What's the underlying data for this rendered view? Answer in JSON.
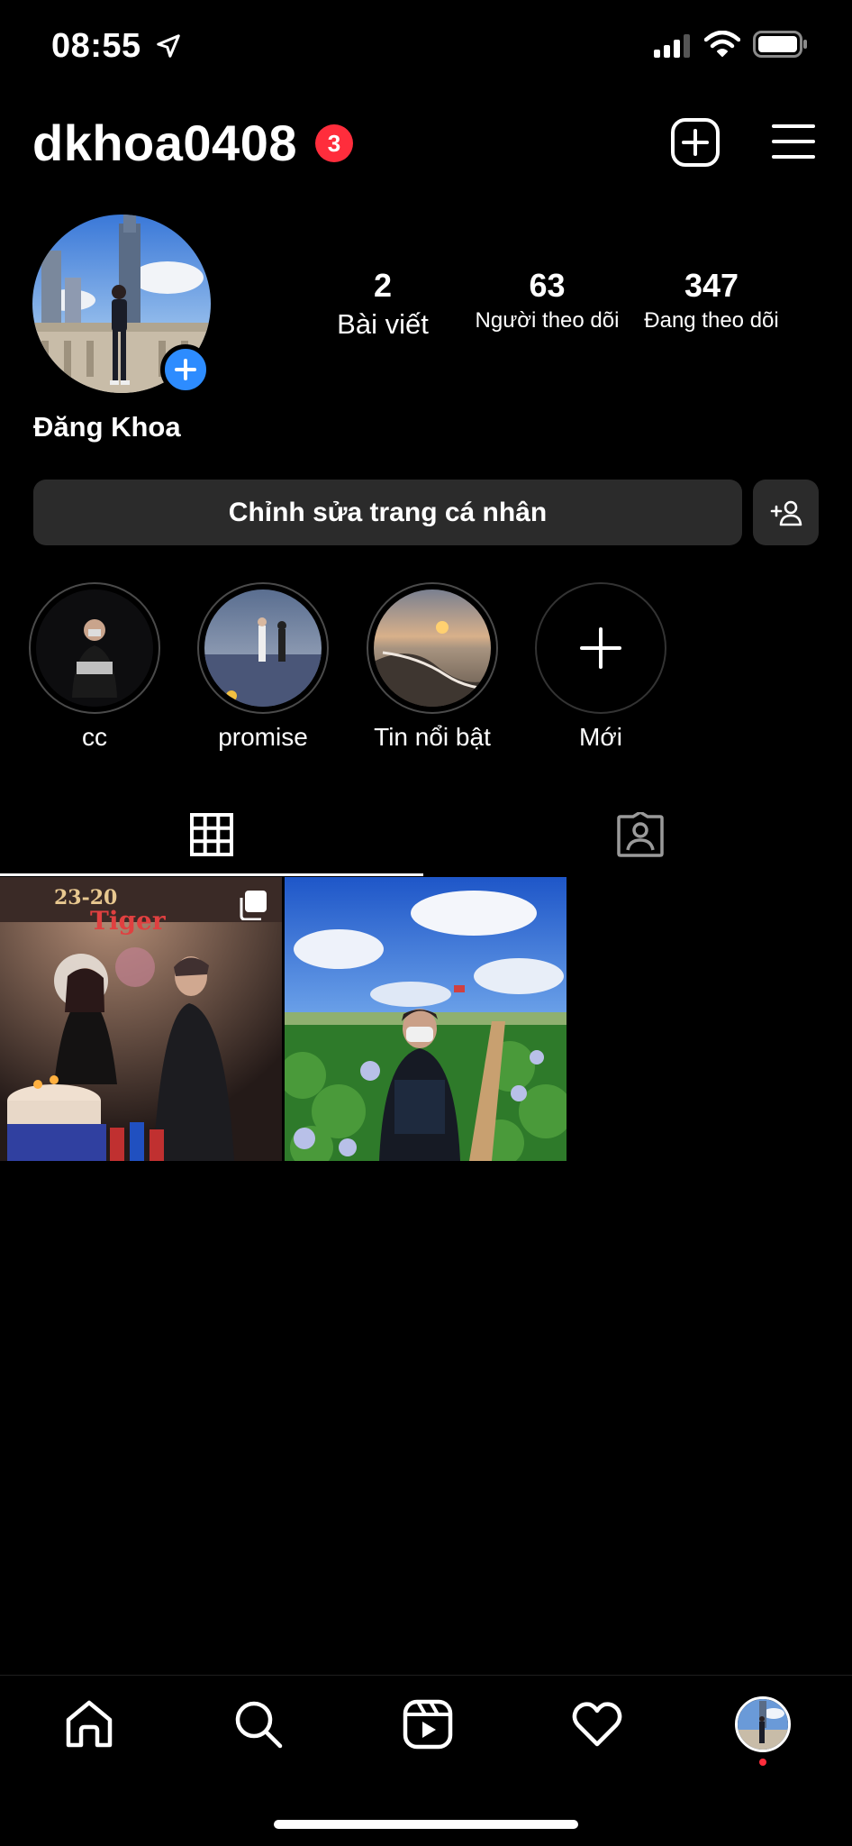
{
  "status_bar": {
    "time": "08:55",
    "location_icon": "location-arrow-icon",
    "signal_icon": "cellular-signal-icon",
    "wifi_icon": "wifi-icon",
    "battery_icon": "battery-icon"
  },
  "header": {
    "username": "dkhoa0408",
    "notification_count": "3",
    "new_post_icon": "plus-square-icon",
    "menu_icon": "hamburger-menu-icon"
  },
  "profile": {
    "display_name": "Đăng Khoa",
    "stats": {
      "posts_count": "2",
      "posts_label": "Bài viết",
      "followers_count": "63",
      "followers_label": "Người theo dõi",
      "following_count": "347",
      "following_label": "Đang theo dõi"
    },
    "edit_button": "Chỉnh sửa trang cá nhân",
    "discover_icon": "add-person-icon"
  },
  "highlights": [
    {
      "label": "cc"
    },
    {
      "label": "promise"
    },
    {
      "label": "Tin nổi bật"
    },
    {
      "label": "Mới"
    }
  ],
  "tabs": {
    "grid_icon": "grid-icon",
    "tagged_icon": "tagged-person-icon",
    "active": "grid"
  },
  "colors": {
    "background": "#000000",
    "button_bg": "#2b2b2b",
    "badge_red": "#ff2d3c",
    "accent_blue": "#2d8cff"
  },
  "bottom_nav": {
    "home_icon": "home-icon",
    "search_icon": "search-icon",
    "reels_icon": "reels-icon",
    "activity_icon": "heart-icon",
    "profile_icon": "profile-avatar-icon"
  }
}
